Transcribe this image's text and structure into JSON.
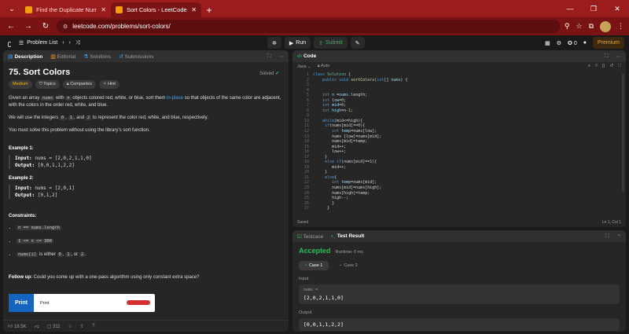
{
  "browser": {
    "tabs": [
      {
        "title": "Find the Duplicate Number - Le",
        "close": "✕"
      },
      {
        "title": "Sort Colors - LeetCode",
        "close": "✕"
      }
    ],
    "url": "leetcode.com/problems/sort-colors/"
  },
  "lc_top": {
    "problem_list": "Problem List",
    "run": "Run",
    "submit": "Submit",
    "streak": "0",
    "premium": "Premium"
  },
  "left_tabs": {
    "description": "Description",
    "editorial": "Editorial",
    "solutions": "Solutions",
    "submissions": "Submissions"
  },
  "problem": {
    "title": "75. Sort Colors",
    "solved": "Solved",
    "tags": {
      "difficulty": "Medium",
      "topics": "Topics",
      "companies": "Companies",
      "hint": "Hint"
    },
    "p1_a": "Given an array ",
    "p1_code": "nums",
    "p1_b": " with ",
    "p1_code2": "n",
    "p1_c": " objects colored red, white, or blue, sort them ",
    "p1_link": "in-place",
    "p1_d": " so that objects of the same color are adjacent, with the colors in the order red, white, and blue.",
    "p2_a": "We will use the integers ",
    "p2_c0": "0",
    "p2_b": ", ",
    "p2_c1": "1",
    "p2_c": ", and ",
    "p2_c2": "2",
    "p2_d": " to represent the color red, white, and blue, respectively.",
    "p3": "You must solve this problem without using the library's sort function.",
    "ex1_title": "Example 1:",
    "ex1_input_label": "Input:",
    "ex1_input": "nums = [2,0,2,1,1,0]",
    "ex1_output_label": "Output:",
    "ex1_output": "[0,0,1,1,2,2]",
    "ex2_title": "Example 2:",
    "ex2_input_label": "Input:",
    "ex2_input": "nums = [2,0,1]",
    "ex2_output_label": "Output:",
    "ex2_output": "[0,1,2]",
    "constraints_title": "Constraints:",
    "c1": "n == nums.length",
    "c2": "1 <= n <= 300",
    "c3_code": "nums[i]",
    "c3_a": " is either ",
    "c3_0": "0",
    "c3_b": ", ",
    "c3_1": "1",
    "c3_c": ", or ",
    "c3_2": "2",
    "c3_d": ".",
    "followup_label": "Follow up:",
    "followup": " Could you come up with a one-pass algorithm using only constant extra space?",
    "ad_button": "Print",
    "ad_text": "Print",
    "likes": "18.5K",
    "comments": "311"
  },
  "code_panel": {
    "title": "Code",
    "lang": "Java",
    "auto": "Auto",
    "saved": "Saved",
    "position": "Ln 1, Col 1",
    "line_numbers": [
      "1",
      "2",
      "3",
      "4",
      "5",
      "6",
      "7",
      "8",
      "9",
      "10",
      "11",
      "12",
      "13",
      "14",
      "15",
      "16",
      "17",
      "18",
      "19",
      "20",
      "21",
      "22",
      "23",
      "24",
      "25",
      "26",
      "27"
    ]
  },
  "test_panel": {
    "testcase_tab": "Testcase",
    "result_tab": "Test Result",
    "status": "Accepted",
    "runtime": "Runtime: 0 ms",
    "case1": "Case 1",
    "case2": "Case 2",
    "input_label": "Input",
    "input_var": "nums =",
    "input_value": "[2,0,2,1,1,0]",
    "output_label": "Output",
    "output_value": "[0,0,1,1,2,2]"
  }
}
